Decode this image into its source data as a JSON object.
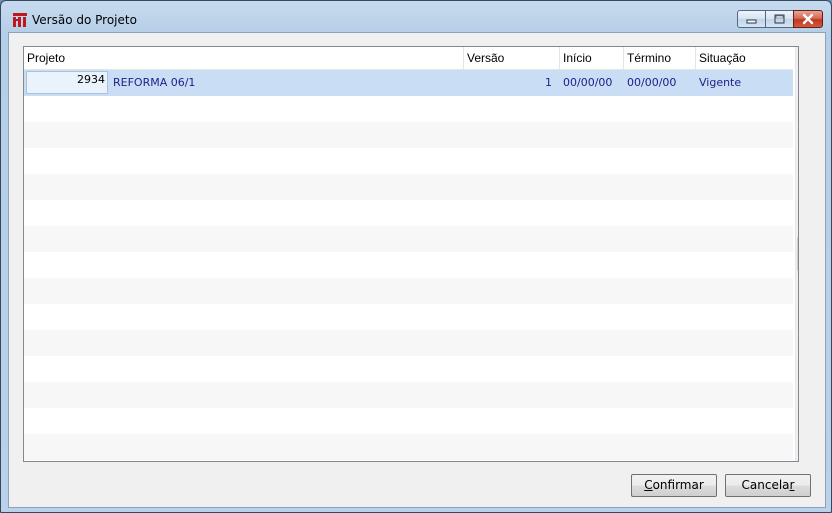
{
  "window": {
    "title": "Versão do Projeto",
    "icon": "app-logo-icon",
    "controls": [
      "minimize-icon",
      "maximize-icon",
      "close-icon"
    ]
  },
  "grid": {
    "columns": [
      {
        "key": "projeto",
        "label": "Projeto"
      },
      {
        "key": "versao",
        "label": "Versão"
      },
      {
        "key": "inicio",
        "label": "Início"
      },
      {
        "key": "termino",
        "label": "Término"
      },
      {
        "key": "situacao",
        "label": "Situação"
      }
    ],
    "rows": [
      {
        "id": "2934",
        "projeto": "REFORMA 06/1",
        "versao": "1",
        "inicio": "00/00/00",
        "termino": "00/00/00",
        "situacao": "Vigente"
      }
    ]
  },
  "buttons": {
    "confirm": {
      "accel": "C",
      "rest": "onfirmar"
    },
    "cancel": {
      "rest": "Cancela",
      "accel": "r"
    }
  },
  "colors": {
    "selected_row": "#c9def5",
    "cell_text": "#1d1d8a",
    "close_button": "#c2381e"
  }
}
